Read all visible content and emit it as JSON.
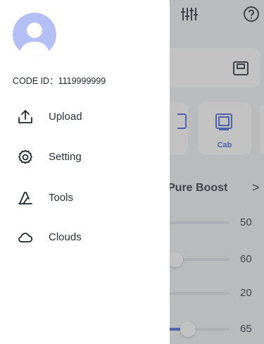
{
  "background": {
    "cards": [
      {
        "label": ""
      },
      {
        "label": "Cab"
      }
    ],
    "section_title": "Pure Boost",
    "chevron": ">",
    "sliders": [
      {
        "value": "50",
        "level": 0.0
      },
      {
        "value": "60",
        "level": 0.05
      },
      {
        "value": "20",
        "level": 0.0
      },
      {
        "value": "65",
        "level": 0.25
      }
    ]
  },
  "drawer": {
    "code_id": "CODE ID：1119999999",
    "menu": [
      {
        "label": "Upload",
        "icon": "upload-icon"
      },
      {
        "label": "Setting",
        "icon": "gear-icon"
      },
      {
        "label": "Tools",
        "icon": "tools-icon"
      },
      {
        "label": "Clouds",
        "icon": "cloud-icon"
      }
    ]
  },
  "colors": {
    "accent": "#3b5bdb",
    "avatar_bg": "#b3bff5",
    "overlay": "rgba(110,110,110,0.42)"
  }
}
